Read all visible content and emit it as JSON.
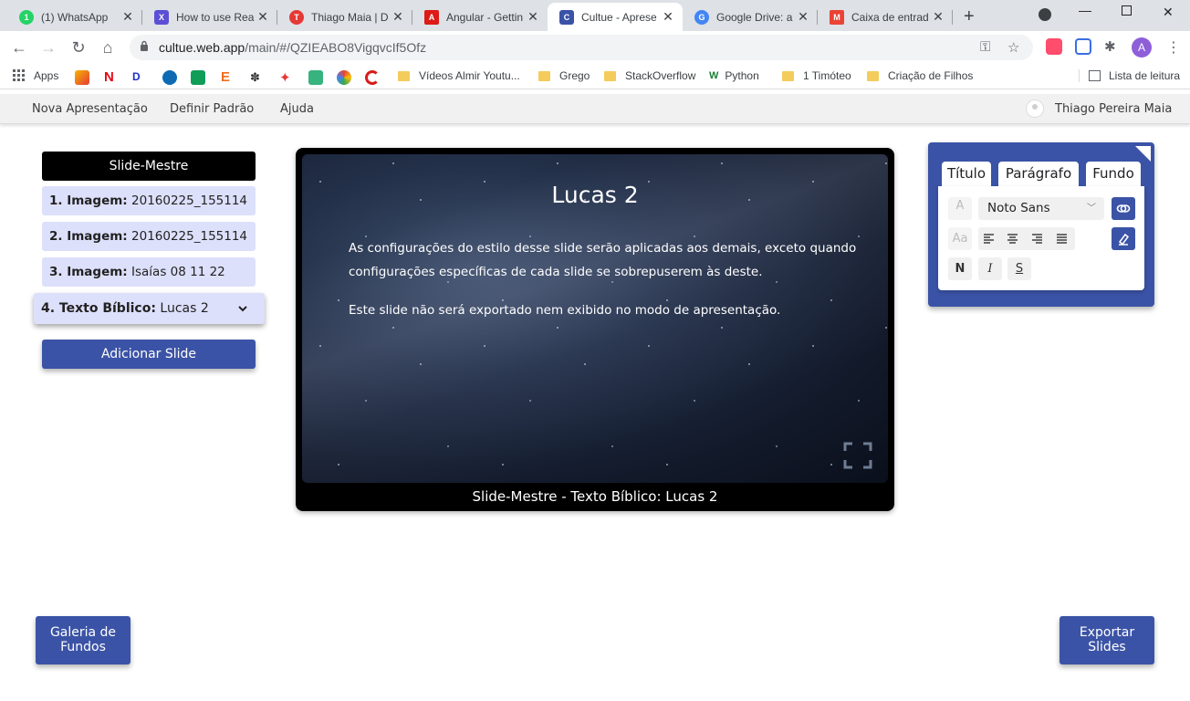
{
  "browser": {
    "tabs": [
      {
        "title": "(1) WhatsApp",
        "favicon": "whatsapp-icon",
        "color": "#25d366",
        "glyph": "1"
      },
      {
        "title": "How to use Rea",
        "favicon": "xcd-icon",
        "color": "#5b4fd6",
        "glyph": "X"
      },
      {
        "title": "Thiago Maia | D",
        "favicon": "t-icon",
        "color": "#e53935",
        "glyph": "T"
      },
      {
        "title": "Angular - Gettin",
        "favicon": "angular-icon",
        "color": "#dd1b16",
        "glyph": "A"
      },
      {
        "title": "Cultue - Aprese",
        "favicon": "cultue-icon",
        "color": "#3b53a6",
        "glyph": "C",
        "active": true
      },
      {
        "title": "Google Drive: a",
        "favicon": "google-icon",
        "color": "#4285f4",
        "glyph": "G"
      },
      {
        "title": "Caixa de entrad",
        "favicon": "gmail-icon",
        "color": "#ea4335",
        "glyph": "M"
      }
    ],
    "new_tab": "+",
    "url_host": "cultue.web.app",
    "url_path": "/main/#/QZIEABO8VigqvcIf5Ofz",
    "profile_initial": "A",
    "bookmarks": [
      {
        "label": "Apps",
        "kind": "apps"
      },
      {
        "label": "Vídeos Almir Youtu...",
        "kind": "folder"
      },
      {
        "label": "Grego",
        "kind": "folder"
      },
      {
        "label": "StackOverflow",
        "kind": "folder"
      },
      {
        "label": "Python",
        "kind": "site"
      },
      {
        "label": "1 Timóteo",
        "kind": "folder"
      },
      {
        "label": "Criação de Filhos",
        "kind": "folder"
      }
    ],
    "reading_list": "Lista de leitura"
  },
  "app": {
    "menu": [
      "Nova Apresentação",
      "Definir Padrão",
      "Ajuda"
    ],
    "user_name": "Thiago Pereira Maia"
  },
  "slides": {
    "master_label": "Slide-Mestre",
    "items": [
      {
        "kind": "1. Imagem:",
        "name": "20160225_155114"
      },
      {
        "kind": "2. Imagem:",
        "name": "20160225_155114"
      },
      {
        "kind": "3. Imagem:",
        "name": "Isaías 08 11 22"
      },
      {
        "kind": "4. Texto Bíblico:",
        "name": "Lucas 2",
        "selected": true
      }
    ],
    "add_label": "Adicionar Slide"
  },
  "preview": {
    "title": "Lucas 2",
    "paragraph1": "As configurações do estilo desse slide serão aplicadas aos demais, exceto quando configurações específicas de cada slide se sobrepuserem às deste.",
    "paragraph2": "Este slide não será exportado nem exibido no modo de apresentação.",
    "caption": "Slide-Mestre - Texto Bíblico: Lucas 2"
  },
  "style_panel": {
    "tabs": [
      "Título",
      "Parágrafo",
      "Fundo"
    ],
    "font_color_glyph": "A",
    "font_name": "Noto Sans",
    "case_glyph": "Aa",
    "bold": "N",
    "italic": "I",
    "underline": "S"
  },
  "bottom": {
    "gallery_label": "Galeria de Fundos",
    "export_label": "Exportar Slides"
  },
  "colors": {
    "accent": "#3b53a6",
    "slide_item_bg": "#dde0fb",
    "master_bg": "#000000"
  }
}
